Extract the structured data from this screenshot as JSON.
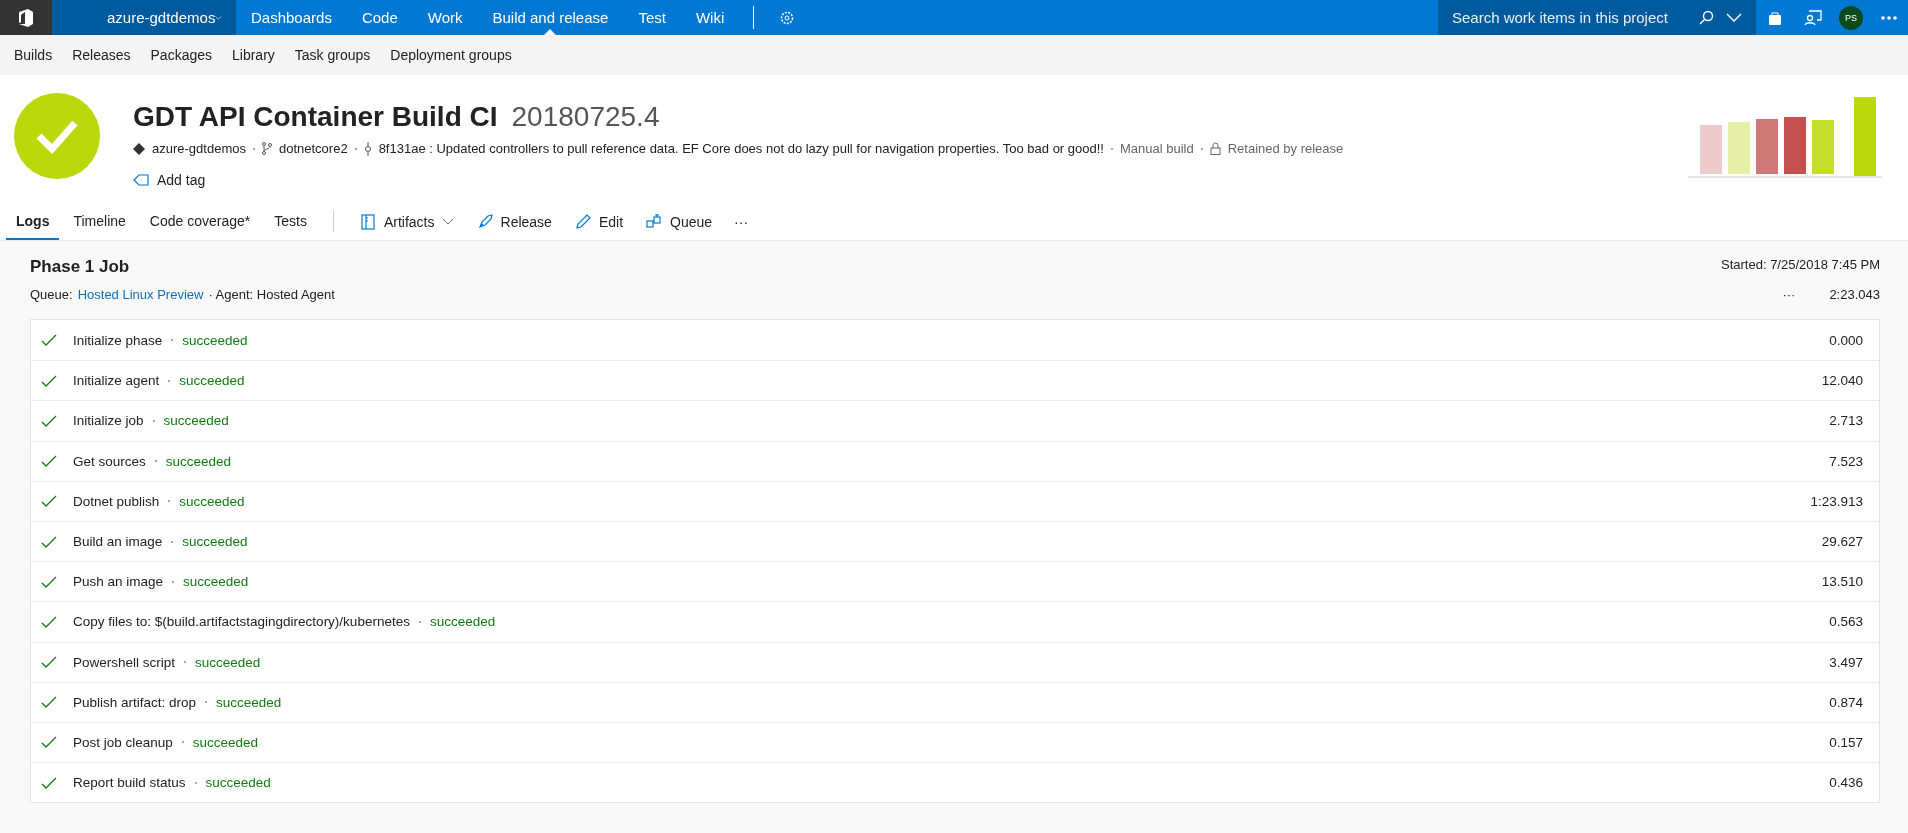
{
  "top_nav": {
    "project": "azure-gdtdemos",
    "items": [
      {
        "label": "Dashboards",
        "selected": false
      },
      {
        "label": "Code",
        "selected": false
      },
      {
        "label": "Work",
        "selected": false
      },
      {
        "label": "Build and release",
        "selected": true
      },
      {
        "label": "Test",
        "selected": false
      },
      {
        "label": "Wiki",
        "selected": false
      }
    ],
    "search": {
      "placeholder": "Search work items in this project"
    },
    "avatar": "PS"
  },
  "sub_nav": [
    "Builds",
    "Releases",
    "Packages",
    "Library",
    "Task groups",
    "Deployment groups"
  ],
  "build": {
    "succeeded": true,
    "name": "GDT API Container Build CI",
    "number": "20180725.4",
    "repository": "azure-gdtdemos",
    "branch": "dotnetcore2",
    "commit": "8f131ae : Updated controllers to pull reference data. EF Core does not do lazy pull for navigation properties. Too bad or good!!",
    "trigger": "Manual build",
    "retention": "Retained by release",
    "add_tag": "Add tag"
  },
  "tabs": [
    {
      "label": "Logs",
      "selected": true
    },
    {
      "label": "Timeline",
      "selected": false
    },
    {
      "label": "Code coverage*",
      "selected": false
    },
    {
      "label": "Tests",
      "selected": false
    }
  ],
  "actions": [
    {
      "kind": "artifacts",
      "label": "Artifacts"
    },
    {
      "kind": "release",
      "label": "Release"
    },
    {
      "kind": "edit",
      "label": "Edit"
    },
    {
      "kind": "queue",
      "label": "Queue"
    },
    {
      "kind": "more",
      "label": "···"
    }
  ],
  "job": {
    "title": "Phase 1 Job",
    "started": "Started: 7/25/2018 7:45 PM",
    "queue_label": "Queue:",
    "queue": "Hosted Linux Preview",
    "agent": "· Agent: Hosted Agent",
    "more": "···",
    "duration": "2:23.043"
  },
  "steps": [
    {
      "name": "Initialize phase",
      "status": "succeeded",
      "time": "0.000"
    },
    {
      "name": "Initialize agent",
      "status": "succeeded",
      "time": "12.040"
    },
    {
      "name": "Initialize job",
      "status": "succeeded",
      "time": "2.713"
    },
    {
      "name": "Get sources",
      "status": "succeeded",
      "time": "7.523"
    },
    {
      "name": "Dotnet publish",
      "status": "succeeded",
      "time": "1:23.913"
    },
    {
      "name": "Build an image",
      "status": "succeeded",
      "time": "29.627"
    },
    {
      "name": "Push an image",
      "status": "succeeded",
      "time": "13.510"
    },
    {
      "name": "Copy files to: $(build.artifactstagingdirectory)/kubernetes",
      "status": "succeeded",
      "time": "0.563"
    },
    {
      "name": "Powershell script",
      "status": "succeeded",
      "time": "3.497"
    },
    {
      "name": "Publish artifact: drop",
      "status": "succeeded",
      "time": "0.874"
    },
    {
      "name": "Post job cleanup",
      "status": "succeeded",
      "time": "0.157"
    },
    {
      "name": "Report build status",
      "status": "succeeded",
      "time": "0.436"
    }
  ]
}
